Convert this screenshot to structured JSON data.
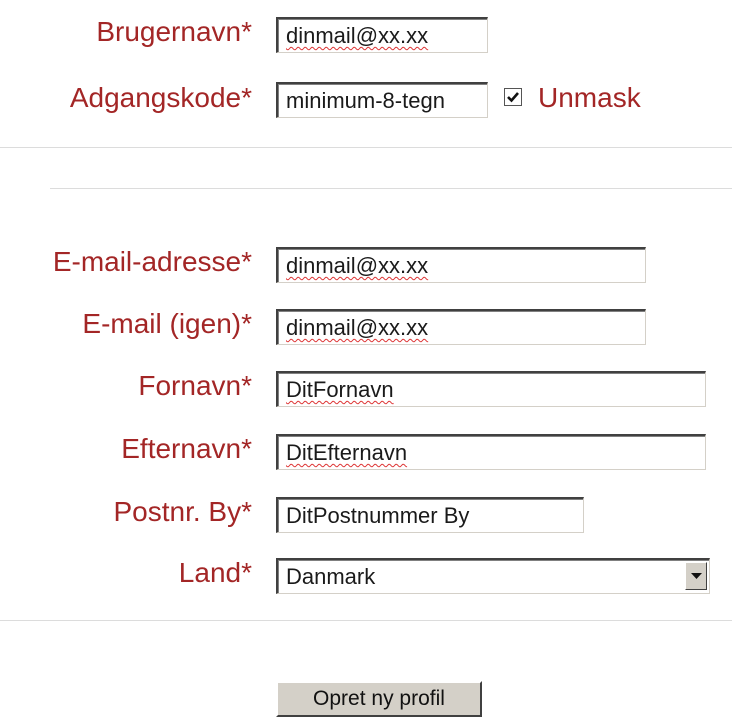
{
  "form": {
    "username": {
      "label": "Brugernavn",
      "required": "*",
      "value": "dinmail@xx.xx"
    },
    "password": {
      "label": "Adgangskode",
      "required": "*",
      "value": "minimum-8-tegn"
    },
    "unmask": {
      "label": "Unmask",
      "checked": true
    },
    "email": {
      "label": "E-mail-adresse",
      "required": "*",
      "value": "dinmail@xx.xx"
    },
    "email_again": {
      "label": "E-mail (igen)",
      "required": "*",
      "value": "dinmail@xx.xx"
    },
    "first_name": {
      "label": "Fornavn",
      "required": "*",
      "value": "DitFornavn"
    },
    "last_name": {
      "label": "Efternavn",
      "required": "*",
      "value": "DitEfternavn"
    },
    "postal_city": {
      "label": "Postnr. By",
      "required": "*",
      "value": "DitPostnummer By"
    },
    "country": {
      "label": "Land",
      "required": "*",
      "value": "Danmark"
    },
    "submit_label": "Opret ny profil"
  },
  "colors": {
    "label": "#a32626",
    "field_border": "#404040",
    "button_face": "#d4d0c8",
    "divider": "#dcdcdc"
  }
}
